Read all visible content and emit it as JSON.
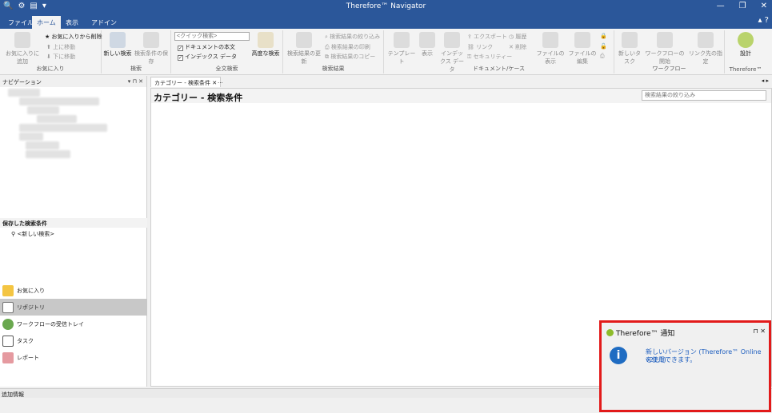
{
  "window": {
    "title": "Therefore™ Navigator"
  },
  "tabs": [
    "ファイル",
    "ホーム",
    "表示",
    "アドイン"
  ],
  "ribbon": {
    "favorites": {
      "add": "お気に入りに追加",
      "remove": "お気に入りから削除",
      "up": "上に移動",
      "down": "下に移動",
      "label": "お気に入り"
    },
    "search": {
      "new": "新しい検索",
      "save": "検索条件の保存",
      "label": "検索"
    },
    "fulltext": {
      "quick_placeholder": "<クイック検索>",
      "doc_body": "ドキュメントの本文",
      "index_data": "インデックス データ",
      "advanced": "高度な検索",
      "label": "全文検索"
    },
    "results": {
      "update": "検索結果の更新",
      "filter": "検索結果の絞り込み",
      "print": "検索結果の印刷",
      "copy": "検索結果のコピー",
      "label": "検索結果"
    },
    "doccase": {
      "template": "テンプレート",
      "view": "表示",
      "index_data": "インデックス データ",
      "export": "エクスポート",
      "history": "履歴",
      "link": "リンク",
      "delete": "削除",
      "security": "セキュリティー",
      "file_view": "ファイルの表示",
      "file_edit": "ファイルの編集",
      "label": "ドキュメント/ケース"
    },
    "workflow": {
      "new_task": "新しいタスク",
      "start": "ワークフローの開始",
      "link_target": "リンク先の指定",
      "label": "ワークフロー"
    },
    "therefore": {
      "design": "設計",
      "label": "Therefore™"
    }
  },
  "nav": {
    "header": "ナビゲーション",
    "saved_header": "保存した検索条件",
    "saved_items": [
      "<新しい検索>"
    ],
    "items": [
      "お気に入り",
      "リポジトリ",
      "ワークフローの受信トレイ",
      "タスク",
      "レポート"
    ]
  },
  "doc": {
    "tab": "カテゴリー - 検索条件",
    "tab_more": "...",
    "title": "カテゴリー - 検索条件",
    "filter_placeholder": "検索結果の絞り込み"
  },
  "bottom": {
    "add_info": "追加情報"
  },
  "notification": {
    "title": "Therefore™ 通知",
    "line1": "新しいバージョン (Therefore™ Online v21.1)",
    "line2": "を使用できます。"
  },
  "colors": {
    "title_bar": "#2b579a",
    "highlight_border": "#e21a1a",
    "info_icon": "#1f6cc2"
  }
}
